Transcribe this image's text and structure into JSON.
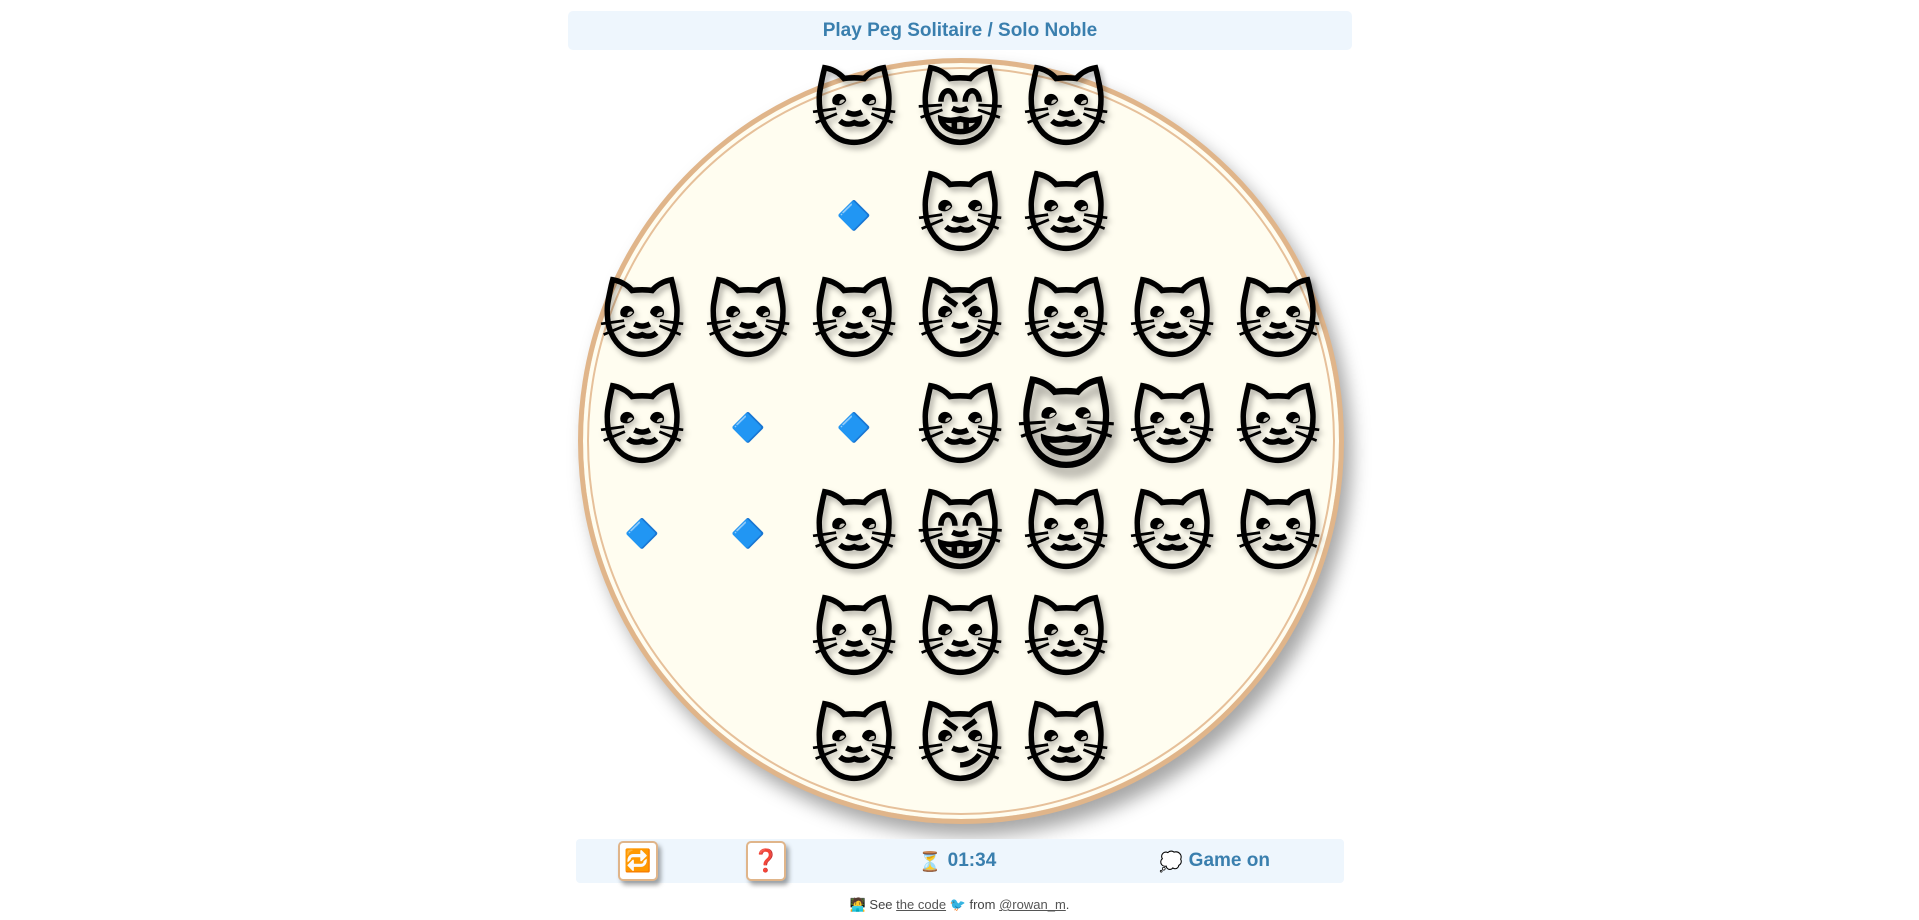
{
  "header": {
    "title": "Play Peg Solitaire / Solo Noble"
  },
  "board": {
    "hole_glyph": "🔷",
    "rows": [
      [
        null,
        null,
        "🐱",
        "😸",
        "🐱",
        null,
        null
      ],
      [
        null,
        null,
        "hole",
        "🐱",
        "🐱",
        null,
        null
      ],
      [
        "🐱",
        "🐱",
        "🐱",
        "😼",
        "🐱",
        "🐱",
        "🐱"
      ],
      [
        "🐱",
        "hole",
        "hole",
        "🐱",
        "😺",
        "🐱",
        "🐱"
      ],
      [
        "hole",
        "hole",
        "🐱",
        "😸",
        "🐱",
        "🐱",
        "🐱"
      ],
      [
        null,
        null,
        "🐱",
        "🐱",
        "🐱",
        null,
        null
      ],
      [
        null,
        null,
        "🐱",
        "😼",
        "🐱",
        null,
        null
      ]
    ],
    "selected": [
      3,
      4
    ]
  },
  "controls": {
    "reset_icon": "🔁",
    "help_icon": "❓",
    "timer_icon": "⏳",
    "timer_value": "01:34",
    "status_icon": "💭",
    "status_text": "Game on"
  },
  "footer": {
    "icon": "🧑‍💻",
    "see": "See",
    "code_link": "the code",
    "bird": "🐦",
    "from": "from",
    "author_link": "@rowan_m",
    "period": "."
  },
  "colors": {
    "accent": "#3a7fae",
    "panel": "#eef6fd",
    "board_bg": "#fffdf0",
    "board_rim": "#e0b58a"
  }
}
